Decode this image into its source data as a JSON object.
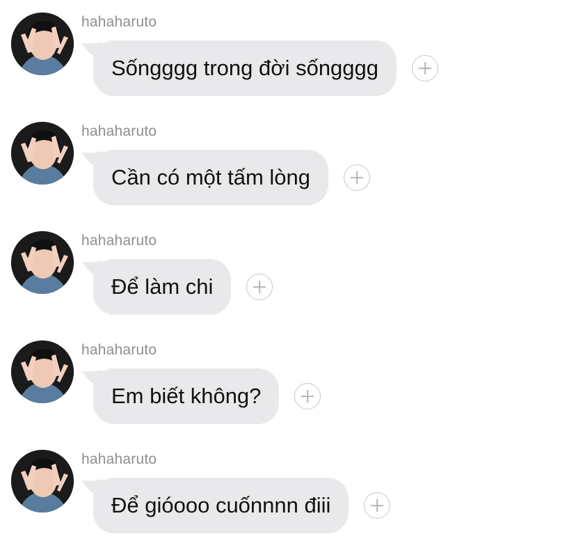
{
  "messages": [
    {
      "sender": "hahaharuto",
      "text": "Sốngggg trong đời sốngggg"
    },
    {
      "sender": "hahaharuto",
      "text": "Cần có một tấm lòng"
    },
    {
      "sender": "hahaharuto",
      "text": "Để làm chi"
    },
    {
      "sender": "hahaharuto",
      "text": "Em biết không?"
    },
    {
      "sender": "hahaharuto",
      "text": "Để gióooo cuốnnnn điii"
    }
  ],
  "icons": {
    "avatar": "user-avatar",
    "reaction": "add-reaction-plus-icon"
  },
  "colors": {
    "bubble": "#e9e9eb",
    "sender_text": "#8e8e93",
    "message_text": "#111111",
    "background": "#ffffff"
  }
}
